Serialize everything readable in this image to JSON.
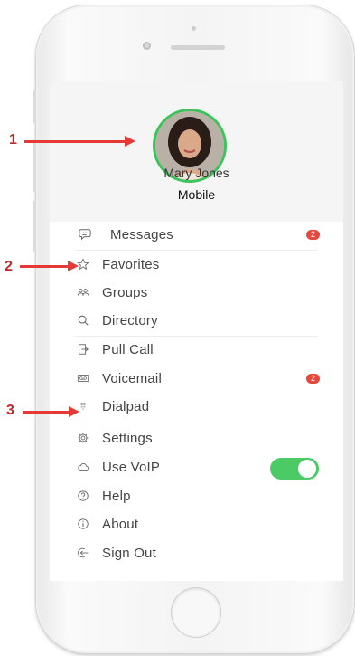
{
  "profile": {
    "name": "Mary Jones",
    "line_type": "Mobile"
  },
  "menu": {
    "items": [
      {
        "label": "Messages",
        "icon": "chat-bubble-icon",
        "badge": "2"
      },
      {
        "label": "Favorites",
        "icon": "star-icon"
      },
      {
        "label": "Groups",
        "icon": "groups-icon"
      },
      {
        "label": "Directory",
        "icon": "search-icon"
      },
      {
        "label": "Pull Call",
        "icon": "pull-call-icon"
      },
      {
        "label": "Voicemail",
        "icon": "voicemail-icon",
        "badge": "2"
      },
      {
        "label": "Dialpad",
        "icon": "dialpad-icon"
      },
      {
        "label": "Settings",
        "icon": "gear-icon"
      },
      {
        "label": "Use VoIP",
        "icon": "cloud-icon",
        "toggle_on": true
      },
      {
        "label": "Help",
        "icon": "help-icon"
      },
      {
        "label": "About",
        "icon": "info-icon"
      },
      {
        "label": "Sign Out",
        "icon": "sign-out-icon"
      }
    ]
  },
  "annotations": [
    "1",
    "2",
    "3"
  ],
  "colors": {
    "accent_green": "#4cca66",
    "badge_red": "#e8483c",
    "annotation_red": "#e53935"
  }
}
